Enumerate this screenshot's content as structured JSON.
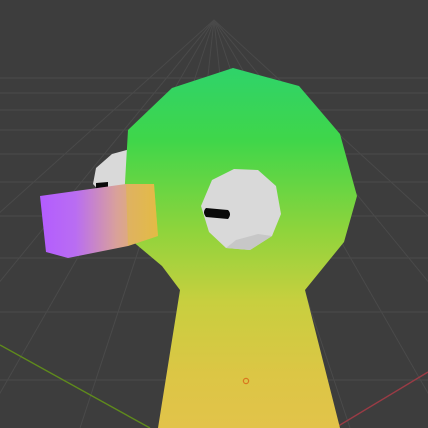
{
  "viewport": {
    "background_color": "#3d3d3d",
    "grid_line_color": "#4a4a4a",
    "x_axis_color": "#9a3b45",
    "y_axis_color": "#5f8a1c"
  },
  "object": {
    "body_gradient": [
      "#2fd36a",
      "#3fd64a",
      "#8ed43c",
      "#c8cf3f",
      "#dcc645",
      "#e2c34a"
    ],
    "eye_color": "#d9d9d9",
    "eye_shadow_color": "#bdbdbd",
    "pupil_color": "#0a0a0a",
    "beak_gradient": [
      "#b35cff",
      "#d9a19a",
      "#e8bd45"
    ],
    "origin_marker_color": "#d9771f"
  }
}
